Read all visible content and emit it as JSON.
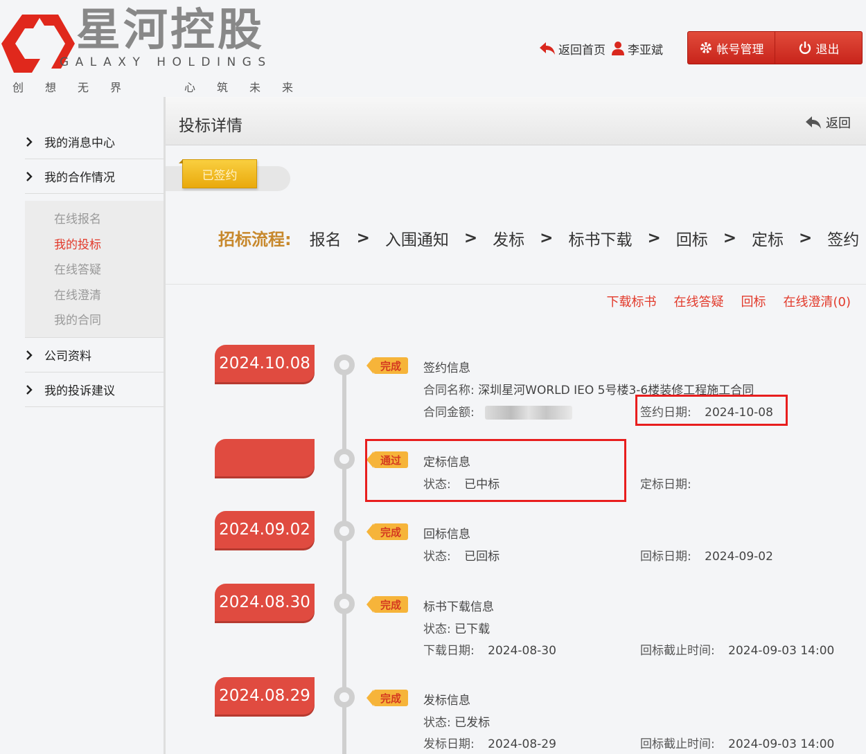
{
  "header": {
    "logo_cn": "星河控股",
    "logo_en": "GALAXY HOLDINGS",
    "slogan": [
      "创",
      "想",
      "无",
      "界",
      "心",
      "筑",
      "未",
      "来"
    ],
    "back_home": "返回首页",
    "user_name": "李亚斌",
    "account_mgmt": "帐号管理",
    "logout": "退出",
    "brand_color": "#d9281e"
  },
  "sidebar": {
    "items": [
      {
        "label": "我的消息中心"
      },
      {
        "label": "我的合作情况"
      },
      {
        "label": "公司资料"
      },
      {
        "label": "我的投诉建议"
      }
    ],
    "sub_items": [
      {
        "label": "在线报名",
        "active": false
      },
      {
        "label": "我的投标",
        "active": true
      },
      {
        "label": "在线答疑",
        "active": false
      },
      {
        "label": "在线澄清",
        "active": false
      },
      {
        "label": "我的合同",
        "active": false
      }
    ]
  },
  "main": {
    "title": "投标详情",
    "back": "返回",
    "status": "已签约",
    "flow_label": "招标流程:",
    "flow_steps": [
      "报名",
      "入围通知",
      "发标",
      "标书下载",
      "回标",
      "定标",
      "签约"
    ],
    "flow_sep": ">",
    "actions": [
      "下载标书",
      "在线答疑",
      "回标",
      "在线澄清(0)"
    ]
  },
  "timeline": [
    {
      "date": "2024.10.08",
      "badge": "完成",
      "title": "签约信息",
      "contract_name_label": "合同名称:",
      "contract_name": "深圳星河WORLD IEO 5号楼3-6楼装修工程施工合同",
      "contract_amount_label": "合同金额:",
      "sign_date_label": "签约日期:",
      "sign_date": "2024-10-08"
    },
    {
      "date": "",
      "badge": "通过",
      "title": "定标信息",
      "status_label": "状态:",
      "status": "已中标",
      "date_label": "定标日期:"
    },
    {
      "date": "2024.09.02",
      "badge": "完成",
      "title": "回标信息",
      "status_label": "状态:",
      "status": "已回标",
      "date_label": "回标日期:",
      "date_value": "2024-09-02"
    },
    {
      "date": "2024.08.30",
      "badge": "完成",
      "title": "标书下载信息",
      "status_label": "状态:",
      "status": "已下载",
      "dl_date_label": "下载日期:",
      "dl_date": "2024-08-30",
      "deadline_label": "回标截止时间:",
      "deadline": "2024-09-03 14:00"
    },
    {
      "date": "2024.08.29",
      "badge": "完成",
      "title": "发标信息",
      "status_label": "状态:",
      "status": "已发标",
      "pub_date_label": "发标日期:",
      "pub_date": "2024-08-29",
      "deadline_label": "回标截止时间:",
      "deadline": "2024-09-03 14:00"
    }
  ]
}
